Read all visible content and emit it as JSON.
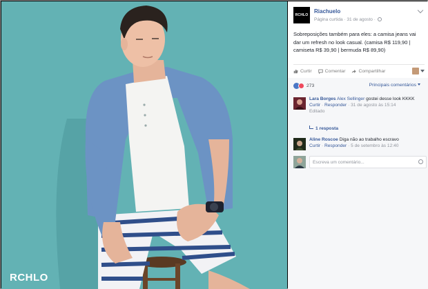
{
  "photo": {
    "watermark": "RCHLO"
  },
  "post": {
    "page_logo_text": "RCHLO",
    "page_name": "Riachuelo",
    "meta_text": "Página curtida · 31 de agosto ·",
    "body": "Sobreposições também para eles: a camisa jeans vai dar um refresh no look casual. (camisa R$ 119,90 | camiseta R$ 39,90 | bermuda R$ 89,90)"
  },
  "actions": {
    "like_label": "Curtir",
    "comment_label": "Comentar",
    "share_label": "Compartilhar"
  },
  "reactions": {
    "count": "273",
    "sort_label": "Principais comentários"
  },
  "comments": [
    {
      "author": "Lara Borges",
      "tag": "Alex Sellinger",
      "text": "gostei desse look KKKK",
      "like_label": "Curtir",
      "reply_label": "Responder",
      "time": "31 de agosto às 15:14",
      "edited": "Editado",
      "replies": "1 resposta"
    },
    {
      "author": "Aline Roscoe",
      "text": "Diga não ao trabalho escravo",
      "like_label": "Curtir",
      "reply_label": "Responder",
      "time": "5 de setembro às 12:40"
    }
  ],
  "compose": {
    "placeholder": "Escreva um comentário..."
  },
  "colors": {
    "photo_background": "#63b2b4",
    "facebook_link": "#365899"
  }
}
